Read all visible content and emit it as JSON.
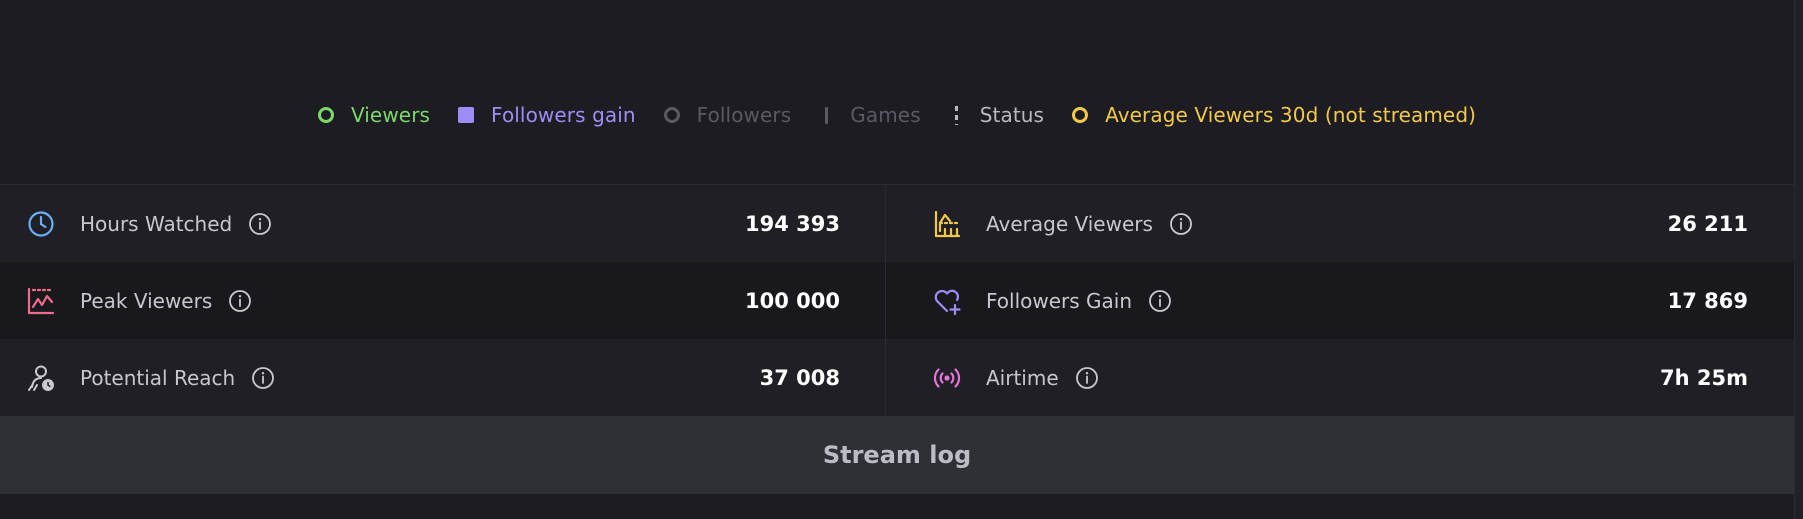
{
  "legend": [
    {
      "label": "Viewers",
      "color": "#7bd96a",
      "marker": "ring",
      "icon": "ring-icon"
    },
    {
      "label": "Followers gain",
      "color": "#a08cf5",
      "marker": "square",
      "icon": "square-icon"
    },
    {
      "label": "Followers",
      "color": "#5a5a63",
      "marker": "ring",
      "icon": "ring-icon"
    },
    {
      "label": "Games",
      "color": "#5a5a63",
      "marker": "bar",
      "icon": "bar-icon"
    },
    {
      "label": "Status",
      "color": "#b9b9c2",
      "marker": "dash",
      "icon": "dashed-line-icon"
    },
    {
      "label": "Average Viewers 30d (not streamed)",
      "color": "#f2c94a",
      "marker": "ring",
      "icon": "ring-icon"
    }
  ],
  "stats": {
    "hours_watched": {
      "label": "Hours Watched",
      "value": "194 393",
      "icon": "clock-icon",
      "color": "#6aaef7"
    },
    "average_viewers": {
      "label": "Average Viewers",
      "value": "26 211",
      "icon": "audience-chart-icon",
      "color": "#f2c94a"
    },
    "peak_viewers": {
      "label": "Peak Viewers",
      "value": "100 000",
      "icon": "peak-chart-icon",
      "color": "#f06a8c"
    },
    "followers_gain": {
      "label": "Followers Gain",
      "value": "17 869",
      "icon": "heart-plus-icon",
      "color": "#a08cf5"
    },
    "potential_reach": {
      "label": "Potential Reach",
      "value": "37 008",
      "icon": "reach-user-icon",
      "color": "#c9c9d1"
    },
    "airtime": {
      "label": "Airtime",
      "value": "7h 25m",
      "icon": "broadcast-icon",
      "color": "#e374d8"
    }
  },
  "stream_log": {
    "label": "Stream log"
  }
}
